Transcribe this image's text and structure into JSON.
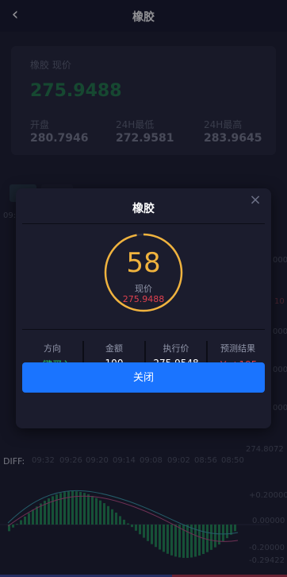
{
  "header": {
    "back_icon": "chevron-left-icon",
    "title": "橡胶"
  },
  "quote": {
    "name_label": "橡胶 现价",
    "price": "275.9488",
    "open_label": "开盘",
    "open_value": "280.7946",
    "low_label": "24H最低",
    "low_value": "272.9581",
    "high_label": "24H最高",
    "high_value": "283.9645"
  },
  "background": {
    "time_label": "09:",
    "axis_labels_right": [
      "0000",
      "0000",
      "0000",
      "0000"
    ],
    "right_side_small": "10",
    "bottom_price_label": "274.8072",
    "diff_label": "DIFF:",
    "time_axis": [
      "09:32",
      "09:26",
      "09:20",
      "09:14",
      "09:08",
      "09:02",
      "08:56",
      "08:50"
    ],
    "macd_axis": [
      "+0.20000",
      "0.00000",
      "-0.20000",
      "-0.29422"
    ]
  },
  "modal": {
    "title": "橡胶",
    "close_icon": "close-x-icon",
    "countdown": "58",
    "current_label": "现价",
    "current_price": "275.9488",
    "progress_fraction": 0.97,
    "columns": [
      {
        "label": "方向",
        "value": "一键买入",
        "color": "#27c26d"
      },
      {
        "label": "金额",
        "value": "100",
        "color": "#ffffff"
      },
      {
        "label": "执行价",
        "value": "275.9548",
        "color": "#ffffff"
      },
      {
        "label": "预测结果",
        "value": "￥ +195",
        "color": "#e0414f"
      }
    ],
    "close_button": "关闭"
  },
  "colors": {
    "accent_blue": "#1a74ff",
    "countdown_gold": "#f0b33e",
    "rise_red": "#e0414f",
    "buy_green": "#27c26d",
    "candle_green": "#1f8a55",
    "candle_red": "#c23a4a"
  }
}
